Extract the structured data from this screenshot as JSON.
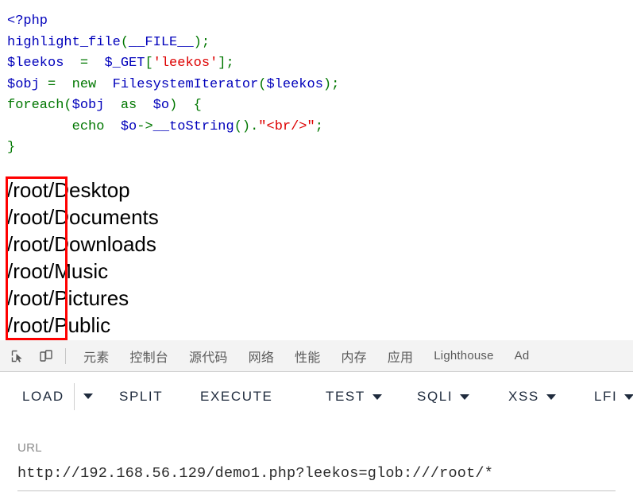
{
  "page": {
    "code": {
      "language": "php",
      "lines": [
        [
          {
            "t": "<?php",
            "c": "blue"
          }
        ],
        [
          {
            "t": "highlight_file",
            "c": "blue"
          },
          {
            "t": "(",
            "c": "green"
          },
          {
            "t": "__FILE__",
            "c": "blue"
          },
          {
            "t": ")",
            "c": "green"
          },
          {
            "t": ";",
            "c": "green"
          }
        ],
        [
          {
            "t": "$leekos",
            "c": "blue"
          },
          {
            "t": "  ",
            "c": "black"
          },
          {
            "t": "=",
            "c": "green"
          },
          {
            "t": "  ",
            "c": "black"
          },
          {
            "t": "$_GET",
            "c": "blue"
          },
          {
            "t": "[",
            "c": "green"
          },
          {
            "t": "'leekos'",
            "c": "red"
          },
          {
            "t": "]",
            "c": "green"
          },
          {
            "t": ";",
            "c": "green"
          }
        ],
        [
          {
            "t": "$obj",
            "c": "blue"
          },
          {
            "t": " ",
            "c": "black"
          },
          {
            "t": "=",
            "c": "green"
          },
          {
            "t": "  ",
            "c": "black"
          },
          {
            "t": "new",
            "c": "green"
          },
          {
            "t": "  ",
            "c": "black"
          },
          {
            "t": "FilesystemIterator",
            "c": "blue"
          },
          {
            "t": "(",
            "c": "green"
          },
          {
            "t": "$leekos",
            "c": "blue"
          },
          {
            "t": ")",
            "c": "green"
          },
          {
            "t": ";",
            "c": "green"
          }
        ],
        [
          {
            "t": "foreach",
            "c": "green"
          },
          {
            "t": "(",
            "c": "green"
          },
          {
            "t": "$obj",
            "c": "blue"
          },
          {
            "t": "  ",
            "c": "black"
          },
          {
            "t": "as",
            "c": "green"
          },
          {
            "t": "  ",
            "c": "black"
          },
          {
            "t": "$o",
            "c": "blue"
          },
          {
            "t": ")",
            "c": "green"
          },
          {
            "t": "  ",
            "c": "black"
          },
          {
            "t": "{",
            "c": "green"
          }
        ],
        [
          {
            "t": "        ",
            "c": "black"
          },
          {
            "t": "echo",
            "c": "green"
          },
          {
            "t": "  ",
            "c": "black"
          },
          {
            "t": "$o",
            "c": "blue"
          },
          {
            "t": "->",
            "c": "green"
          },
          {
            "t": "__toString",
            "c": "blue"
          },
          {
            "t": "()",
            "c": "green"
          },
          {
            "t": ".",
            "c": "green"
          },
          {
            "t": "\"<br/>\"",
            "c": "red"
          },
          {
            "t": ";",
            "c": "green"
          }
        ],
        [
          {
            "t": "}",
            "c": "green"
          }
        ]
      ]
    },
    "output_files": [
      "/root/Desktop",
      "/root/Documents",
      "/root/Downloads",
      "/root/Music",
      "/root/Pictures",
      "/root/Public"
    ],
    "highlight_box_color": "#ff0000"
  },
  "devtools": {
    "icons": [
      {
        "name": "inspect-element-icon",
        "glyph": "inspect"
      },
      {
        "name": "device-toolbar-icon",
        "glyph": "device"
      }
    ],
    "tabs": [
      {
        "label": "元素",
        "latin": false
      },
      {
        "label": "控制台",
        "latin": false
      },
      {
        "label": "源代码",
        "latin": false
      },
      {
        "label": "网络",
        "latin": false
      },
      {
        "label": "性能",
        "latin": false
      },
      {
        "label": "内存",
        "latin": false
      },
      {
        "label": "应用",
        "latin": false
      },
      {
        "label": "Lighthouse",
        "latin": true
      },
      {
        "label": "Ad",
        "latin": true
      }
    ],
    "active_tab": null,
    "background": "#f3f3f3",
    "text_color": "#5a5a5a"
  },
  "toolbar": {
    "buttons": [
      {
        "label": "LOAD",
        "has_caret": false
      },
      {
        "label": "",
        "has_caret": true,
        "caret_only": true
      },
      {
        "label": "SPLIT",
        "has_caret": false
      },
      {
        "label": "EXECUTE",
        "has_caret": false
      },
      {
        "label": "TEST",
        "has_caret": true
      },
      {
        "label": "SQLI",
        "has_caret": true
      },
      {
        "label": "XSS",
        "has_caret": true
      },
      {
        "label": "LFI",
        "has_caret": true
      }
    ],
    "text_color": "#1f2b3d"
  },
  "url_field": {
    "label": "URL",
    "value": "http://192.168.56.129/demo1.php?leekos=glob:///root/*",
    "placeholder": "URL"
  }
}
